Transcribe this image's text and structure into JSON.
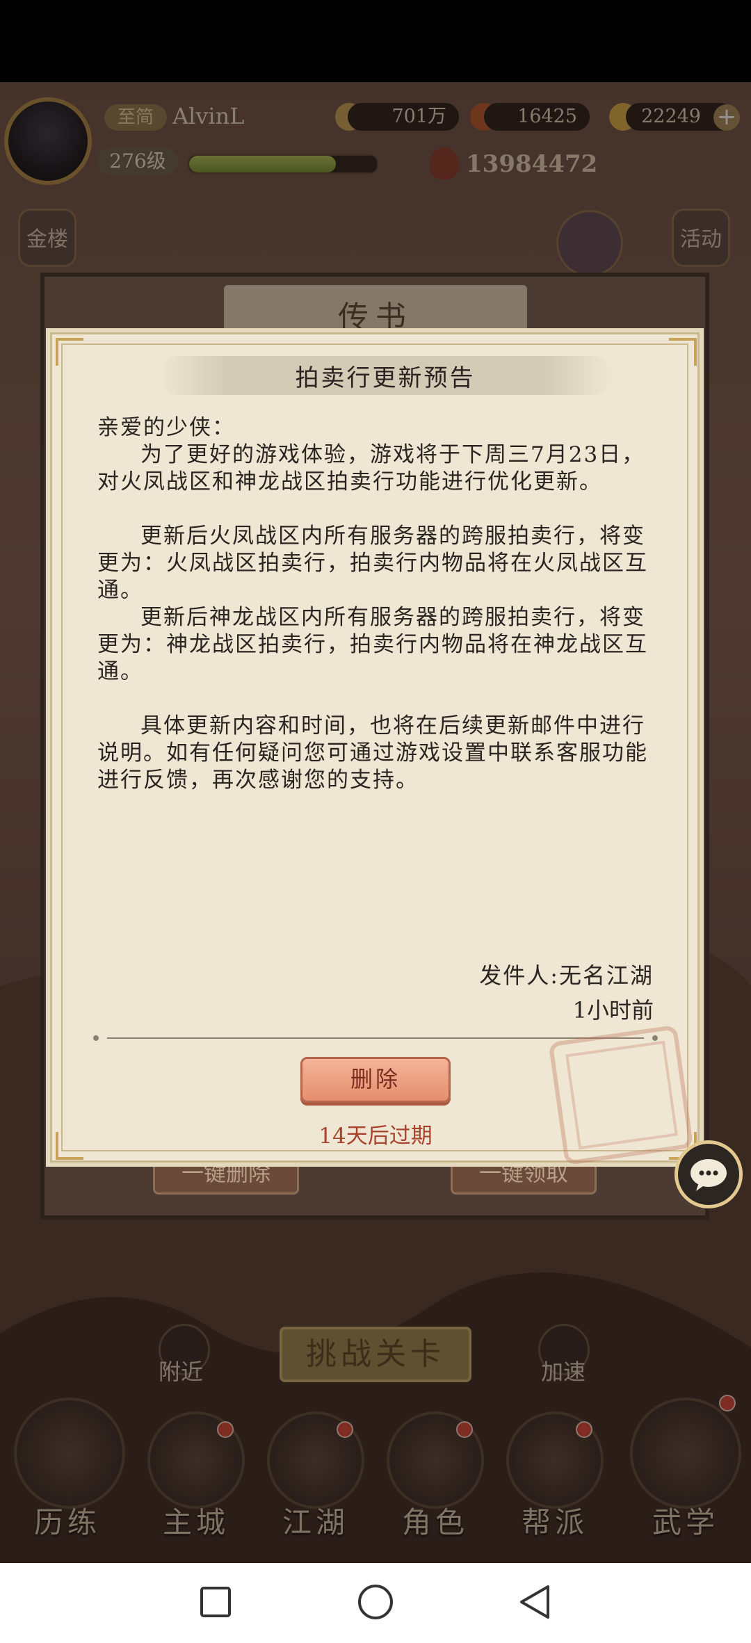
{
  "player": {
    "vip_label": "至简",
    "name": "AlvinL",
    "level": "276级",
    "xp_fraction": 0.78,
    "silver": "701万",
    "gems": "16425",
    "gold": "22249",
    "power": "13984472"
  },
  "side_buttons": {
    "left_top": "金楼",
    "right_top": "活动"
  },
  "back_panel": {
    "title": "传书",
    "delete_all": "一键删除",
    "claim_all": "一键领取"
  },
  "mail": {
    "title": "拍卖行更新预告",
    "greeting": "亲爱的少侠：",
    "paragraph1": "为了更好的游戏体验，游戏将于下周三7月23日，对火凤战区和神龙战区拍卖行功能进行优化更新。",
    "paragraph2": "更新后火凤战区内所有服务器的跨服拍卖行，将变更为：火凤战区拍卖行，拍卖行内物品将在火凤战区互通。",
    "paragraph3": "更新后神龙战区内所有服务器的跨服拍卖行，将变更为：神龙战区拍卖行，拍卖行内物品将在神龙战区互通。",
    "paragraph4": "具体更新内容和时间，也将在后续更新邮件中进行说明。如有任何疑问您可通过游戏设置中联系客服功能进行反馈，再次感谢您的支持。",
    "sender": "发件人:无名江湖",
    "sent_time": "1小时前",
    "delete_label": "删除",
    "expiry": "14天后过期"
  },
  "bottom": {
    "challenge": "挑战关卡",
    "nearby": "附近",
    "speedup": "加速",
    "nav": [
      "历练",
      "主城",
      "江湖",
      "角色",
      "帮派",
      "武学"
    ]
  },
  "colors": {
    "paper": "#efe7d3",
    "delete_button": "#e58d6d",
    "expiry_text": "#a8442e",
    "notification_dot": "#d84a3a"
  },
  "icons": {
    "chat": "chat-bubble-icon",
    "nav_recent": "square-icon",
    "nav_home": "circle-icon",
    "nav_back": "triangle-back-icon"
  }
}
